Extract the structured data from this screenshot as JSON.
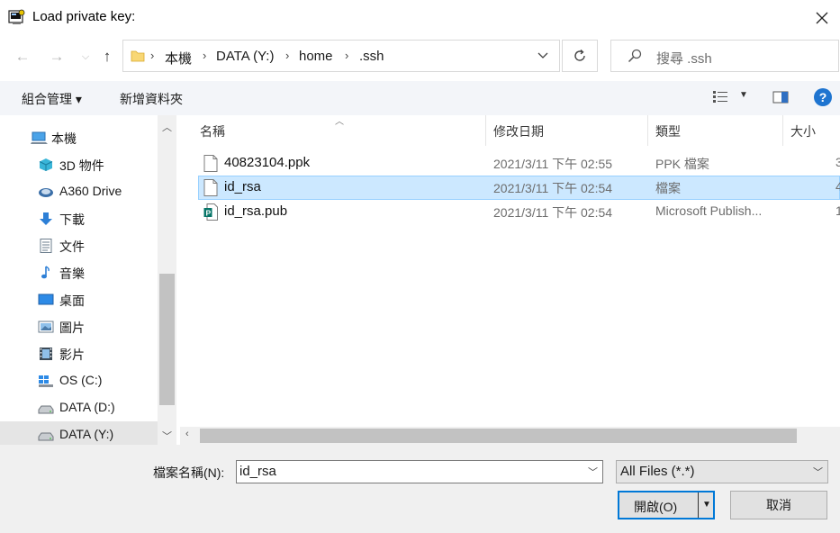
{
  "window": {
    "title": "Load private key:"
  },
  "address": {
    "crumbs": [
      "本機",
      "DATA (Y:)",
      "home",
      ".ssh"
    ]
  },
  "search": {
    "placeholder": "搜尋 .ssh"
  },
  "toolbar": {
    "organize": "組合管理 ▾",
    "new_folder": "新增資料夾",
    "help": "?"
  },
  "nav": {
    "items": [
      {
        "label": "本機",
        "icon": "computer-icon"
      },
      {
        "label": "3D 物件",
        "icon": "cube-icon"
      },
      {
        "label": "A360 Drive",
        "icon": "cloud-drive-icon"
      },
      {
        "label": "下載",
        "icon": "download-icon"
      },
      {
        "label": "文件",
        "icon": "document-icon"
      },
      {
        "label": "音樂",
        "icon": "music-icon"
      },
      {
        "label": "桌面",
        "icon": "desktop-icon"
      },
      {
        "label": "圖片",
        "icon": "picture-icon"
      },
      {
        "label": "影片",
        "icon": "video-icon"
      },
      {
        "label": "OS (C:)",
        "icon": "windows-drive-icon"
      },
      {
        "label": "DATA (D:)",
        "icon": "drive-icon"
      },
      {
        "label": "DATA (Y:)",
        "icon": "drive-icon",
        "selected": true
      }
    ]
  },
  "columns": {
    "name": "名稱",
    "date": "修改日期",
    "type": "類型",
    "size": "大小"
  },
  "files": [
    {
      "name": "40823104.ppk",
      "date": "2021/3/11 下午 02:55",
      "type": "PPK 檔案",
      "size": "3",
      "icon": "file-icon"
    },
    {
      "name": "id_rsa",
      "date": "2021/3/11 下午 02:54",
      "type": "檔案",
      "size": "4",
      "icon": "file-icon",
      "selected": true
    },
    {
      "name": "id_rsa.pub",
      "date": "2021/3/11 下午 02:54",
      "type": "Microsoft Publish...",
      "size": "1",
      "icon": "publisher-icon"
    }
  ],
  "bottom": {
    "filename_label": "檔案名稱(N):",
    "filename_value": "id_rsa",
    "filter_value": "All Files (*.*)",
    "open_label": "開啟(O)",
    "cancel_label": "取消"
  },
  "colors": {
    "selection": "#cce8ff",
    "accent": "#0078d7",
    "help": "#1e74d0"
  }
}
